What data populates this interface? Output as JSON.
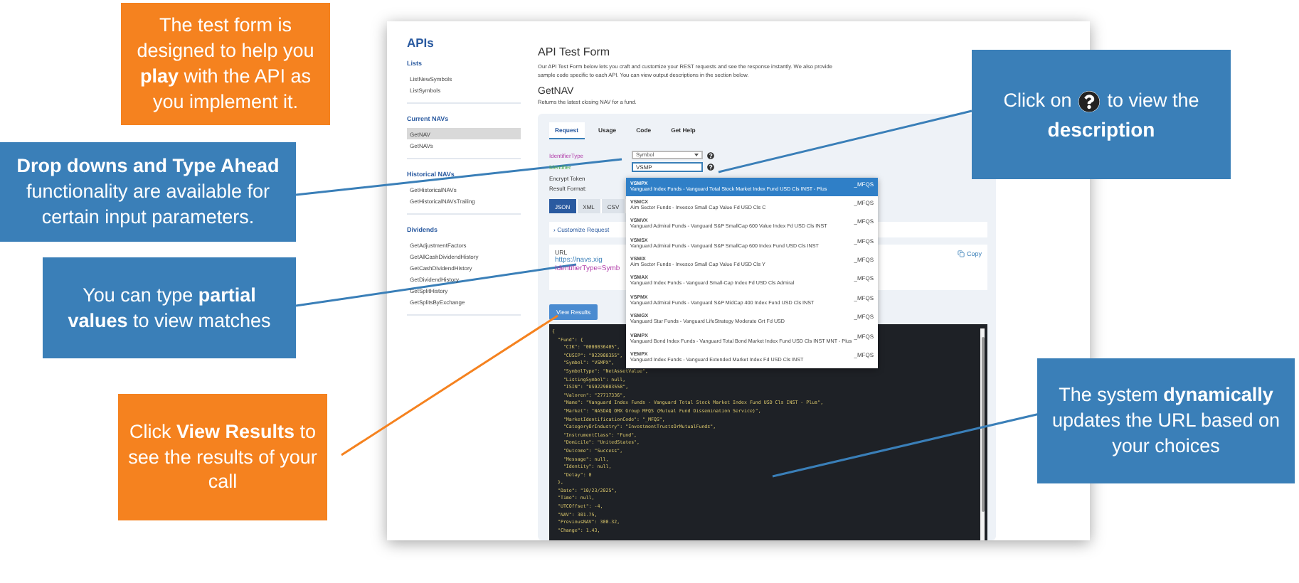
{
  "sidebar": {
    "title": "APIs",
    "sections": [
      {
        "heading": "Lists",
        "items": [
          {
            "label": "ListNewSymbols",
            "selected": false
          },
          {
            "label": "ListSymbols",
            "selected": false
          }
        ]
      },
      {
        "heading": "Current NAVs",
        "items": [
          {
            "label": "GetNAV",
            "selected": true
          },
          {
            "label": "GetNAVs",
            "selected": false
          }
        ]
      },
      {
        "heading": "Historical NAVs",
        "items": [
          {
            "label": "GetHistoricalNAVs",
            "selected": false
          },
          {
            "label": "GetHistoricalNAVsTrailing",
            "selected": false
          }
        ]
      },
      {
        "heading": "Dividends",
        "items": [
          {
            "label": "GetAdjustmentFactors",
            "selected": false
          },
          {
            "label": "GetAllCashDividendHistory",
            "selected": false
          },
          {
            "label": "GetCashDividendHistory",
            "selected": false
          },
          {
            "label": "GetDividendHistory",
            "selected": false
          },
          {
            "label": "GetSplitHistory",
            "selected": false
          },
          {
            "label": "GetSplitsByExchange",
            "selected": false
          }
        ]
      }
    ]
  },
  "page": {
    "title": "API Test Form",
    "intro": "Our API Test Form below lets you craft and customize your REST requests and see the response instantly. We also provide sample code specific to each API. You can view output descriptions in the section below.",
    "api_name": "GetNAV",
    "api_description": "Returns the latest closing NAV for a fund."
  },
  "tabs": [
    {
      "label": "Request",
      "selected": true
    },
    {
      "label": "Usage",
      "selected": false
    },
    {
      "label": "Code",
      "selected": false
    },
    {
      "label": "Get Help",
      "selected": false
    }
  ],
  "form": {
    "identifier_type": {
      "label": "IdentifierType",
      "value": "Symbol"
    },
    "identifier": {
      "label": "Identifier",
      "value": "VSMP"
    },
    "encrypt_token": {
      "label": "Encrypt Token"
    },
    "result_format": {
      "label": "Result Format:",
      "options": [
        {
          "label": "JSON",
          "selected": true
        },
        {
          "label": "XML",
          "selected": false
        },
        {
          "label": "CSV",
          "selected": false
        }
      ]
    },
    "customize": {
      "icon": "›",
      "label": "Customize Request"
    },
    "url": {
      "label": "URL",
      "line_1": "https://navs.xig",
      "line_2": "IdentifierType=Symb",
      "copy": "Copy"
    },
    "submit": "View Results"
  },
  "suggestions": [
    {
      "symbol": "VSMPX",
      "name": "Vanguard Index Funds - Vanguard Total Stock Market Index Fund USD Cls INST - Plus",
      "market": "_MFQS",
      "selected": true
    },
    {
      "symbol": "VSMCX",
      "name": "Aim Sector Funds - Invesco Small Cap Value Fd USD Cls C",
      "market": "_MFQS",
      "selected": false
    },
    {
      "symbol": "VSMVX",
      "name": "Vanguard Admiral Funds - Vanguard S&P SmallCap 600 Value Index Fd USD Cls INST",
      "market": "_MFQS",
      "selected": false
    },
    {
      "symbol": "VSMSX",
      "name": "Vanguard Admiral Funds - Vanguard S&P SmallCap 600 Index Fund USD Cls INST",
      "market": "_MFQS",
      "selected": false
    },
    {
      "symbol": "VSMIX",
      "name": "Aim Sector Funds - Invesco Small Cap Value Fd USD Cls Y",
      "market": "_MFQS",
      "selected": false
    },
    {
      "symbol": "VSMAX",
      "name": "Vanguard Index Funds - Vanguard Small-Cap Index Fd USD Cls Admiral",
      "market": "_MFQS",
      "selected": false
    },
    {
      "symbol": "VSPMX",
      "name": "Vanguard Admiral Funds - Vanguard S&P MidCap 400 Index Fund USD Cls INST",
      "market": "_MFQS",
      "selected": false
    },
    {
      "symbol": "VSMGX",
      "name": "Vanguard Star Funds - Vanguard LifeStrategy Moderate Grt Fd USD",
      "market": "_MFQS",
      "selected": false
    },
    {
      "symbol": "VBMPX",
      "name": "Vanguard Bond Index Funds - Vanguard Total Bond Market Index Fund USD Cls INST MNT - Plus",
      "market": "_MFQS",
      "selected": false
    },
    {
      "symbol": "VEMPX",
      "name": "Vanguard Index Funds - Vanguard Extended Market Index Fd USD Cls INST",
      "market": "_MFQS",
      "selected": false
    }
  ],
  "response_lines": [
    "{",
    "  \"Fund\": {",
    "    \"CIK\": \"0000036405\",",
    "    \"CUSIP\": \"922908355\",",
    "    \"Symbol\": \"VSMPX\",",
    "    \"SymbolType\": \"NetAssetValue\",",
    "    \"ListingSymbol\": null,",
    "    \"ISIN\": \"US9229083558\",",
    "    \"Valoren\": \"27717336\",",
    "    \"Name\": \"Vanguard Index Funds - Vanguard Total Stock Market Index Fund USD Cls INST - Plus\",",
    "    \"Market\": \"NASDAQ OMX Group MFQS (Mutual Fund Dissemination Service)\",",
    "    \"MarketIdentificationCode\": \"_MFQS\",",
    "    \"CategoryOrIndustry\": \"InvestmentTrustsOrMutualFunds\",",
    "    \"InstrumentClass\": \"Fund\",",
    "    \"Domicile\": \"UnitedStates\",",
    "    \"Outcome\": \"Success\",",
    "    \"Message\": null,",
    "    \"Identity\": null,",
    "    \"Delay\": 0",
    "  },",
    "  \"Date\": \"10/23/2025\",",
    "  \"Time\": null,",
    "  \"UTCOffset\": -4,",
    "  \"NAV\": 301.75,",
    "  \"PreviousNAV\": 300.32,",
    "  \"Change\": 1.43,"
  ],
  "callouts": [
    {
      "kind": "note",
      "color": "#f5821f",
      "text": "The test form is designed to help you **play** with the API as you implement it."
    },
    {
      "kind": "note",
      "color": "#3a7fb8",
      "text": "**Drop downs and Type Ahead** functionality are available for certain input parameters."
    },
    {
      "kind": "note",
      "color": "#3a7fb8",
      "text": "You can type **partial values** to view matches"
    },
    {
      "kind": "note",
      "color": "#f5821f",
      "text": "Click **View Results** to see the results of your call"
    },
    {
      "kind": "icon_note",
      "color": "#3a7fb8",
      "text_before": "Click on",
      "text_after": "to view the",
      "text_end": "description"
    },
    {
      "kind": "note",
      "color": "#3a7fb8",
      "text": "The system **dynamically** updates the URL based on your choices"
    }
  ]
}
